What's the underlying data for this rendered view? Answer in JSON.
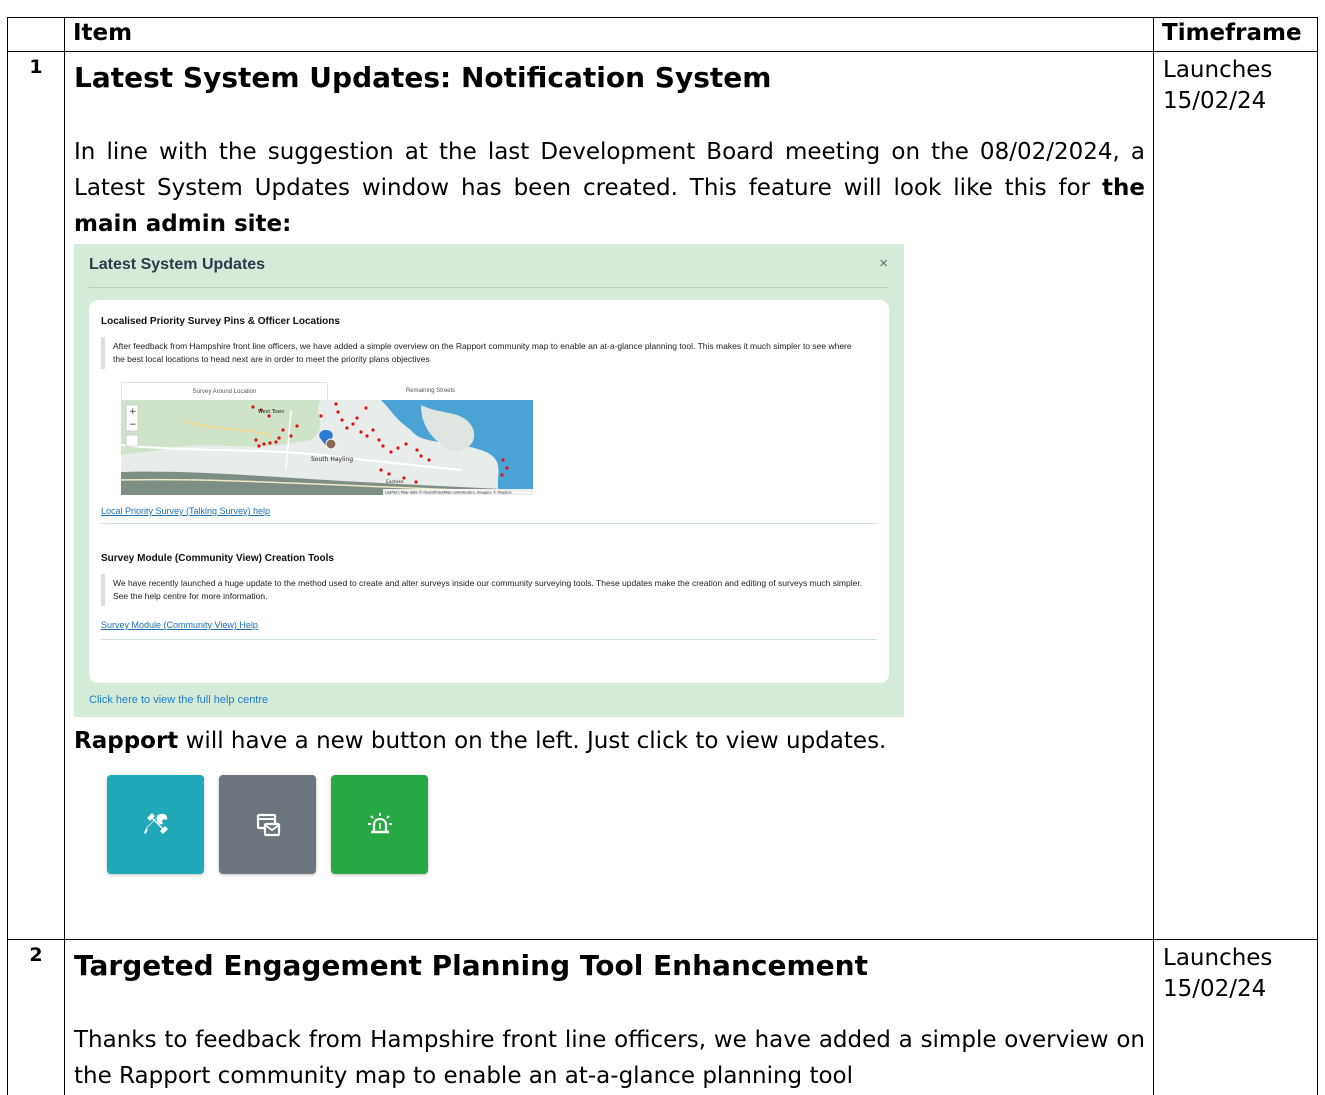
{
  "table": {
    "header": {
      "num": "",
      "item": "Item",
      "timeframe": "Timeframe"
    }
  },
  "rows": [
    {
      "num": "1",
      "title": "Latest System Updates: Notification System",
      "intro": "In line with the suggestion at the last Development Board meeting on the 08/02/2024, a Latest System Updates window has been created.  This feature will look like this for ",
      "intro_bold": "the main admin site:",
      "timeframe_line1": "Launches",
      "timeframe_line2": "15/02/24",
      "rapport_bold": "Rapport",
      "rapport_text": " will have a new button on the left.  Just click to view updates."
    },
    {
      "num": "2",
      "title": "Targeted Engagement Planning Tool Enhancement",
      "body": "Thanks to feedback from Hampshire front line officers, we have added a simple overview on the Rapport community map to enable an at-a-glance planning tool",
      "timeframe_line1": "Launches",
      "timeframe_line2": "15/02/24"
    }
  ],
  "modal": {
    "title": "Latest System Updates",
    "close": "×",
    "section1": {
      "title": "Localised Priority Survey Pins & Officer Locations",
      "text": "After feedback from Hampshire front line officers, we have added a simple overview on the Rapport community map to enable an at-a-glance planning tool.  This makes it much simpler to see where the best local locations to head next are in order to meet the priority plans objectives",
      "tab1": "Survey Around Location",
      "tab2": "Remaining Streets",
      "map_labels": {
        "town1": "West Town",
        "town2": "South Hayling",
        "town3": "Eastoke",
        "attribution": "Leaflet | Map data © OpenStreetMap contributors, Imagery © Mapbox",
        "zoom_in": "+",
        "zoom_out": "−"
      },
      "link": "Local Priority Survey (Talking Survey) help"
    },
    "section2": {
      "title": "Survey Module (Community View) Creation Tools",
      "text": "We have recently launched a huge update to the method used to create and alter surveys inside our community surveying tools. These updates make the creation and editing of surveys much simpler. See the help centre for more information.",
      "link": "Survey Module (Community View) Help"
    },
    "footer_link": "Click here to view the full help centre"
  },
  "buttons": [
    {
      "icon": "tools-icon",
      "color": "#20a8b8"
    },
    {
      "icon": "messages-icon",
      "color": "#6c757d"
    },
    {
      "icon": "alarm-icon",
      "color": "#28a745"
    }
  ]
}
